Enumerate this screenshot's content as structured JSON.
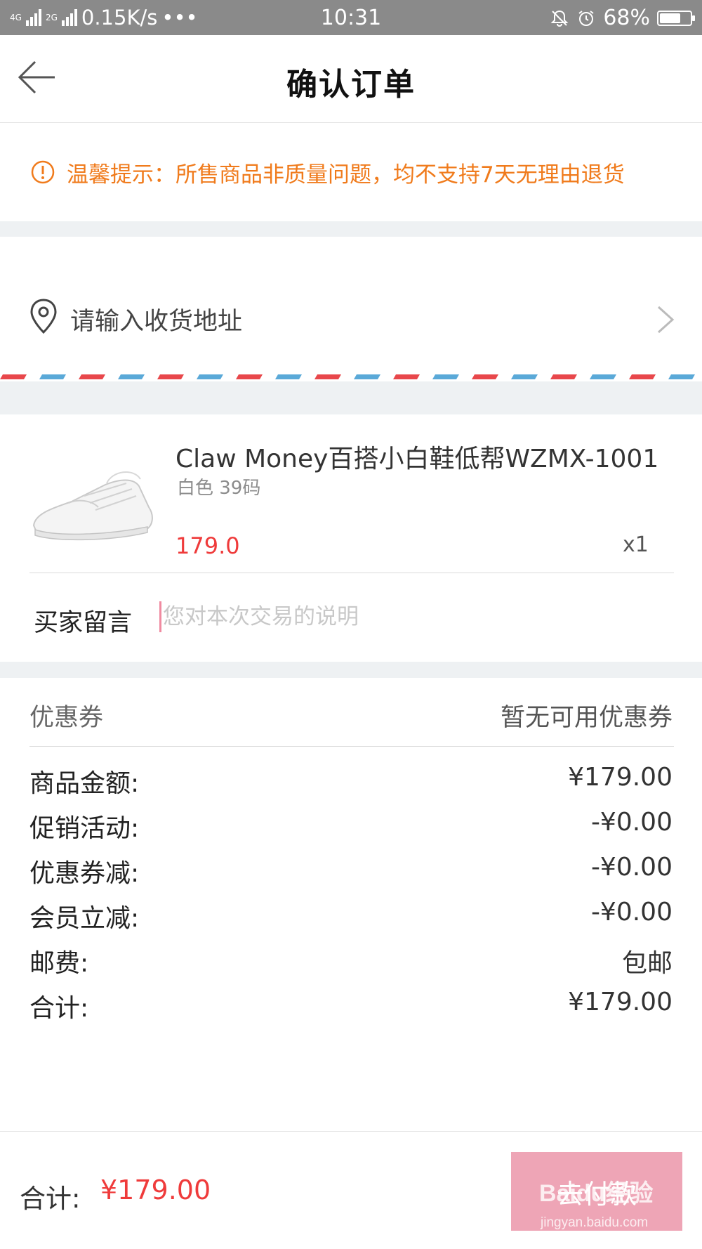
{
  "status_bar": {
    "network_1": "4G",
    "network_2": "4G",
    "network_3": "2G",
    "speed": "0.15K/s",
    "more": "•••",
    "time": "10:31",
    "battery_percent_label": "68%",
    "battery_level": 0.68
  },
  "header": {
    "title": "确认订单"
  },
  "notice": {
    "text": "温馨提示：所售商品非质量问题，均不支持7天无理由退货",
    "color": "#f07b1c"
  },
  "address": {
    "placeholder": "请输入收货地址"
  },
  "product": {
    "name": "Claw Money百搭小白鞋低帮WZMX-1001",
    "spec": "白色 39码",
    "price": "179.0",
    "quantity": "x1",
    "image_icon": "white-sneaker-image"
  },
  "buyer_message": {
    "label": "买家留言",
    "placeholder": "您对本次交易的说明"
  },
  "coupon": {
    "label": "优惠券",
    "value": "暂无可用优惠券"
  },
  "summary": [
    {
      "label": "商品金额:",
      "value": "¥179.00"
    },
    {
      "label": "促销活动:",
      "value": "-¥0.00"
    },
    {
      "label": "优惠券减:",
      "value": "-¥0.00"
    },
    {
      "label": "会员立减:",
      "value": "-¥0.00"
    },
    {
      "label": "邮费:",
      "value": "包邮"
    },
    {
      "label": "合计:",
      "value": "¥179.00"
    }
  ],
  "footer": {
    "total_label": "合计:",
    "total_amount": "¥179.00",
    "pay_label": "去付款",
    "watermark": "Baidu经验",
    "watermark_url": "jingyan.baidu.com"
  },
  "colors": {
    "accent_red": "#ef3b3b",
    "warning_orange": "#f07b1c",
    "pay_button": "#eea5b6",
    "airmail_red": "#e8474b",
    "airmail_blue": "#5aa9d8"
  }
}
